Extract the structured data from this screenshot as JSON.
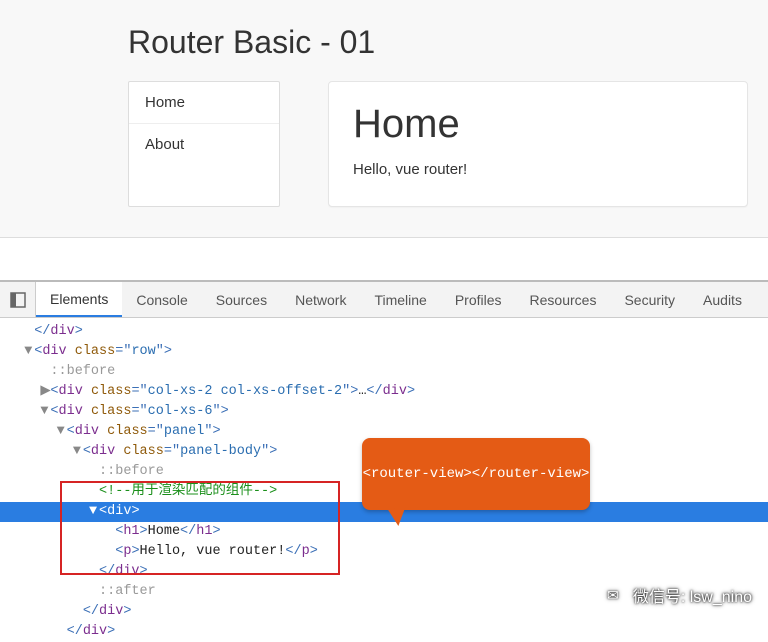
{
  "page": {
    "title": "Router Basic - 01"
  },
  "nav": {
    "items": [
      {
        "label": "Home"
      },
      {
        "label": "About"
      }
    ]
  },
  "panel": {
    "heading": "Home",
    "text": "Hello, vue router!"
  },
  "devtools": {
    "tabs": [
      "Elements",
      "Console",
      "Sources",
      "Network",
      "Timeline",
      "Profiles",
      "Resources",
      "Security",
      "Audits"
    ],
    "active_tab": "Elements",
    "dom_lines": [
      {
        "indent": 1,
        "caret": "",
        "kind": "close",
        "text": "</div>"
      },
      {
        "indent": 1,
        "caret": "▼",
        "kind": "open",
        "tag": "div",
        "attrs": [
          [
            "class",
            "row"
          ]
        ]
      },
      {
        "indent": 2,
        "caret": "",
        "kind": "pseudo",
        "text": "::before"
      },
      {
        "indent": 2,
        "caret": "▶",
        "kind": "openclose",
        "tag": "div",
        "attrs": [
          [
            "class",
            "col-xs-2 col-xs-offset-2"
          ]
        ],
        "ellipsis": true
      },
      {
        "indent": 2,
        "caret": "▼",
        "kind": "open",
        "tag": "div",
        "attrs": [
          [
            "class",
            "col-xs-6"
          ]
        ]
      },
      {
        "indent": 3,
        "caret": "▼",
        "kind": "open",
        "tag": "div",
        "attrs": [
          [
            "class",
            "panel"
          ]
        ]
      },
      {
        "indent": 4,
        "caret": "▼",
        "kind": "open",
        "tag": "div",
        "attrs": [
          [
            "class",
            "panel-body"
          ]
        ]
      },
      {
        "indent": 5,
        "caret": "",
        "kind": "pseudo",
        "text": "::before"
      },
      {
        "indent": 5,
        "caret": "",
        "kind": "comment",
        "text": "<!--用于渲染匹配的组件-->"
      },
      {
        "indent": 5,
        "caret": "▼",
        "kind": "open",
        "tag": "div",
        "attrs": [],
        "highlight": true
      },
      {
        "indent": 6,
        "caret": "",
        "kind": "inline",
        "tag": "h1",
        "inner": "Home"
      },
      {
        "indent": 6,
        "caret": "",
        "kind": "inline",
        "tag": "p",
        "inner": "Hello, vue router!"
      },
      {
        "indent": 5,
        "caret": "",
        "kind": "close",
        "text": "</div>"
      },
      {
        "indent": 5,
        "caret": "",
        "kind": "pseudo",
        "text": "::after"
      },
      {
        "indent": 4,
        "caret": "",
        "kind": "close",
        "text": "</div>"
      },
      {
        "indent": 3,
        "caret": "",
        "kind": "close",
        "text": "</div>"
      }
    ]
  },
  "callout": {
    "text": "<router-view></router-view>"
  },
  "watermark": {
    "label": "微信号: lsw_nino"
  }
}
